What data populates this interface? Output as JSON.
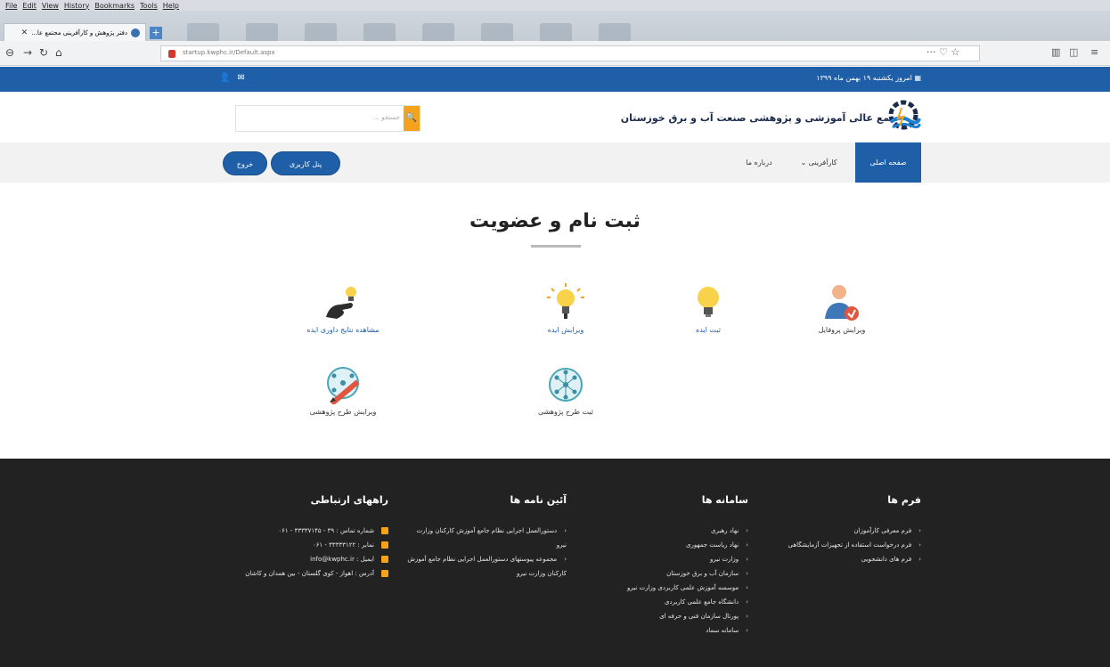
{
  "browser": {
    "menu": [
      "File",
      "Edit",
      "View",
      "History",
      "Bookmarks",
      "Tools",
      "Help"
    ],
    "tab_title": "دفتر پژوهش و کارآفرینی مجتمع عا...",
    "new_tab": "+",
    "url": "startup.kwphc.ir/Default.aspx",
    "url_right": "··· ♡ ☆"
  },
  "topstrip": {
    "date": "امروز یکشنبه ۱۹ بهمن ماه ۱۳۹۹"
  },
  "header": {
    "site_name": "مجتمع عالی آموزشی و پژوهشی صنعت آب و برق خوزستان",
    "search_placeholder": "... جستجو"
  },
  "nav": {
    "items": [
      "صفحه اصلی",
      "کارآفرینی ⌄",
      "درباره ما"
    ],
    "panel_button": "پنل کاربری",
    "logout_button": "خروج"
  },
  "main": {
    "title": "ثبت نام و عضویت",
    "tiles": [
      {
        "label": "ویرایش پروفایل",
        "icon": "user-edit-icon"
      },
      {
        "label": "ثبت ایده",
        "icon": "lightbulb-icon"
      },
      {
        "label": "ویرایش ایده",
        "icon": "lightbulb-shining-icon"
      },
      {
        "label": "مشاهده نتایج داوری ایده",
        "icon": "hand-lightbulb-icon"
      },
      {
        "label": "ثبت طرح پژوهشی",
        "icon": "network-icon"
      },
      {
        "label": "ویرایش طرح پژوهشی",
        "icon": "network-pencil-icon"
      }
    ]
  },
  "footer": {
    "forms": {
      "title": "فرم ها",
      "items": [
        "فرم معرفی کارآموزان",
        "فرم درخواست استفاده از تجهیزات آزمایشگاهی",
        "فرم های دانشجویی"
      ]
    },
    "systems": {
      "title": "سامانه ها",
      "items": [
        "نهاد رهبری",
        "نهاد ریاست جمهوری",
        "وزارت نیرو",
        "سازمان آب و برق خوزستان",
        "موسسه آموزش علمی کاربردی وزارت نیرو",
        "دانشگاه جامع علمی کاربردی",
        "پورتال سازمان فنی و حرفه ای",
        "سامانه سماد"
      ]
    },
    "regulations": {
      "title": "آئین نامه ها",
      "items": [
        "دستورالعمل اجرایی نظام جامع آموزش کارکنان وزارت نیرو",
        "مجموعه پیوستهای دستورالعمل اجرایی نظام جامع آموزش کارکنان وزارت نیرو"
      ]
    },
    "contacts": {
      "title": "راههای ارتباطی",
      "items": [
        "شماره تماس : ۳۹ - ۳۳۳۳۷۱۴۵ - ۰۶۱",
        "نمابر : ۳۳۳۳۳۱۲۲ - ۰۶۱",
        "ایمیل : info@kwphc.ir",
        "آدرس : اهواز - کوی گلستان - بین همدان و کاشان"
      ]
    }
  }
}
